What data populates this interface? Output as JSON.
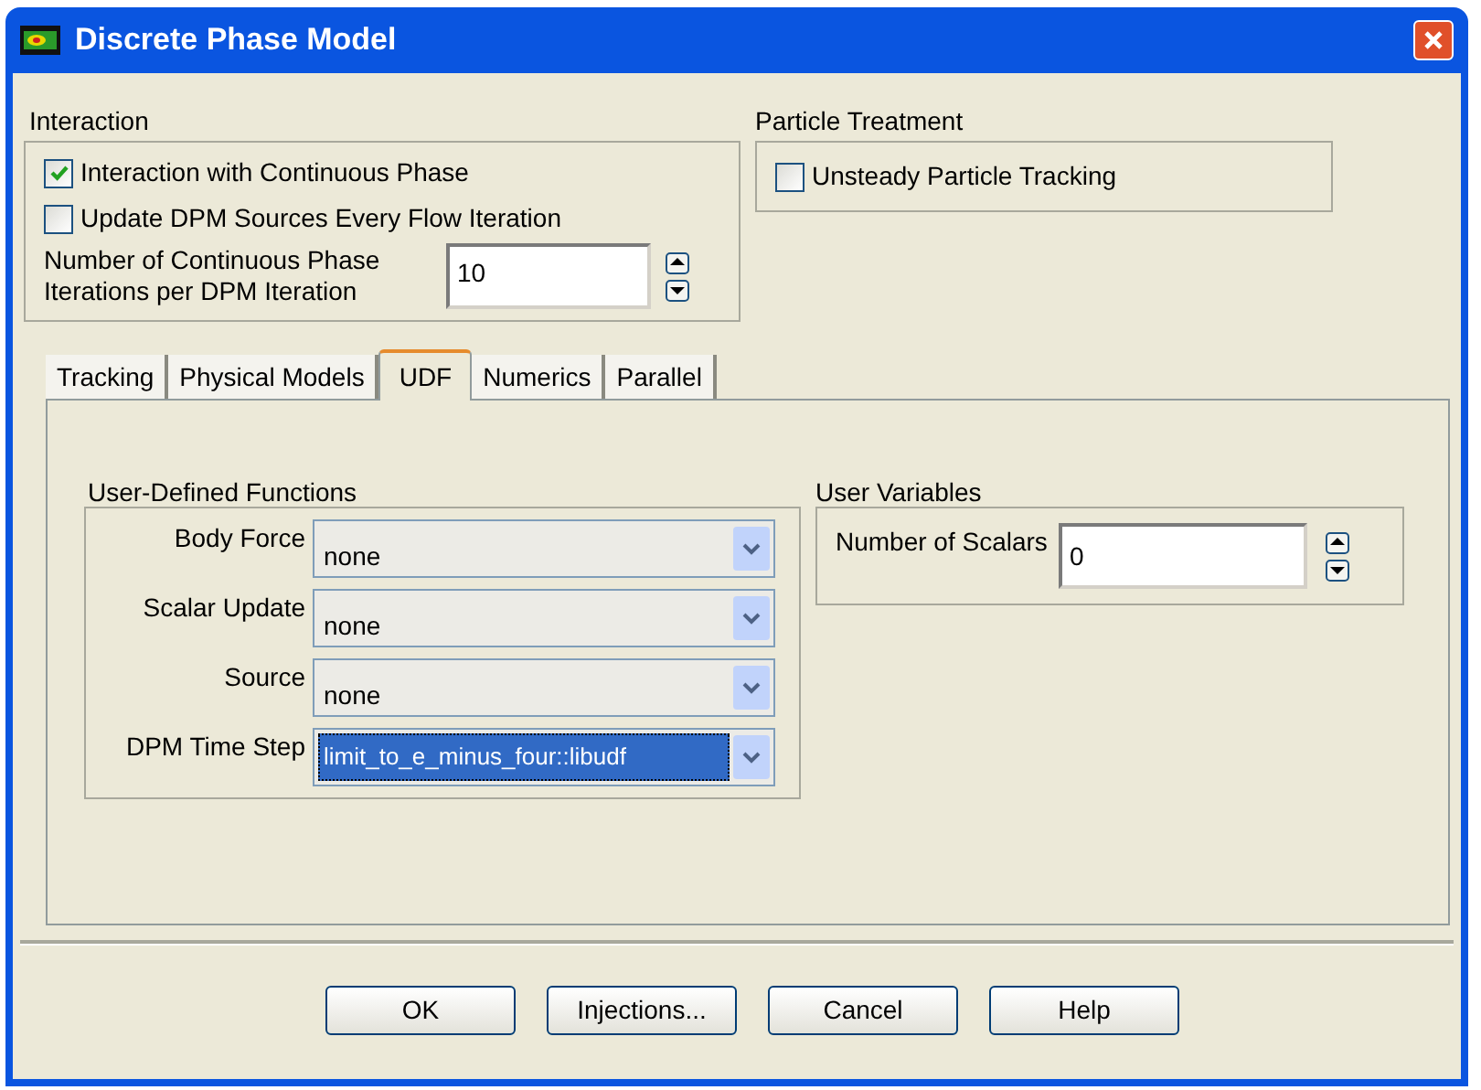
{
  "window": {
    "title": "Discrete Phase Model"
  },
  "interaction": {
    "title": "Interaction",
    "options": [
      {
        "label": "Interaction with Continuous Phase",
        "checked": true
      },
      {
        "label": "Update DPM Sources Every Flow Iteration",
        "checked": false
      }
    ],
    "iterations": {
      "label": "Number of Continuous Phase Iterations per DPM Iteration",
      "value": "10"
    }
  },
  "particle_treatment": {
    "title": "Particle Treatment",
    "options": [
      {
        "label": "Unsteady Particle Tracking",
        "checked": false
      }
    ]
  },
  "tabs": [
    {
      "label": "Tracking",
      "selected": false
    },
    {
      "label": "Physical Models",
      "selected": false
    },
    {
      "label": "UDF",
      "selected": true
    },
    {
      "label": "Numerics",
      "selected": false
    },
    {
      "label": "Parallel",
      "selected": false
    }
  ],
  "udf": {
    "title": "User-Defined Functions",
    "fields": [
      {
        "label": "Body Force",
        "value": "none",
        "focused": false
      },
      {
        "label": "Scalar Update",
        "value": "none",
        "focused": false
      },
      {
        "label": "Source",
        "value": "none",
        "focused": false
      },
      {
        "label": "DPM Time Step",
        "value": "limit_to_e_minus_four::libudf",
        "focused": true
      }
    ]
  },
  "user_variables": {
    "title": "User Variables",
    "scalars": {
      "label": "Number of Scalars",
      "value": "0"
    }
  },
  "buttons": [
    "OK",
    "Injections...",
    "Cancel",
    "Help"
  ]
}
